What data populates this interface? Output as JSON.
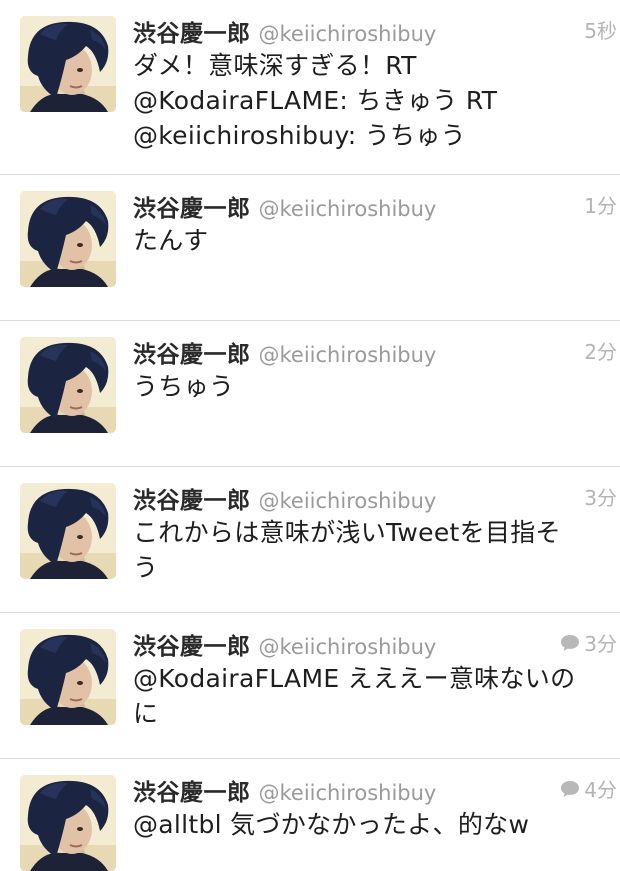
{
  "colors": {
    "name": "#2a2a2a",
    "handle": "#9a9a9a",
    "time": "#b4b4b4",
    "text": "#1e1e1e",
    "divider": "#dcdcdc"
  },
  "tweets": [
    {
      "name": "渋谷慶一郎",
      "handle": "@keiichiroshibuy",
      "time": "5秒",
      "lines": [
        "ダメ！意味深すぎる！RT",
        "@KodairaFLAME: ちきゅう RT",
        "@keiichiroshibuy: うちゅう"
      ],
      "has_reply_icon": false
    },
    {
      "name": "渋谷慶一郎",
      "handle": "@keiichiroshibuy",
      "time": "1分",
      "lines": [
        "たんす"
      ],
      "has_reply_icon": false
    },
    {
      "name": "渋谷慶一郎",
      "handle": "@keiichiroshibuy",
      "time": "2分",
      "lines": [
        "うちゅう"
      ],
      "has_reply_icon": false
    },
    {
      "name": "渋谷慶一郎",
      "handle": "@keiichiroshibuy",
      "time": "3分",
      "lines": [
        "これからは意味が浅いTweetを目指そ",
        "う"
      ],
      "has_reply_icon": false
    },
    {
      "name": "渋谷慶一郎",
      "handle": "@keiichiroshibuy",
      "time": "3分",
      "lines": [
        "@KodairaFLAME えええー意味ないの",
        "に"
      ],
      "has_reply_icon": true,
      "icon": "speech-bubble-icon"
    },
    {
      "name": "渋谷慶一郎",
      "handle": "@keiichiroshibuy",
      "time": "4分",
      "lines": [
        "@alltbl 気づかなかったよ、的なw"
      ],
      "has_reply_icon": true,
      "icon": "speech-bubble-icon"
    }
  ]
}
